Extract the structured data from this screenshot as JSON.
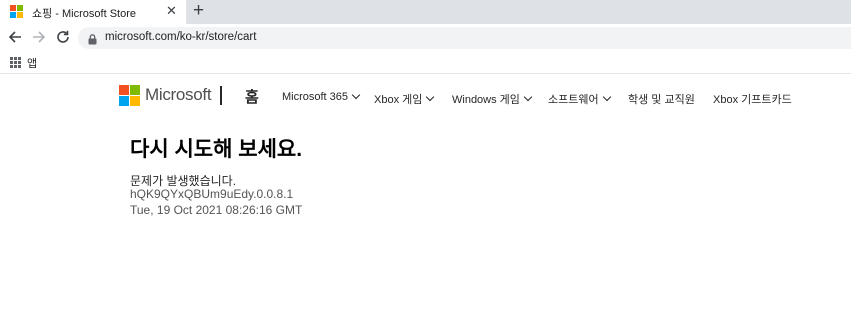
{
  "browser": {
    "tab": {
      "title": "쇼핑 - Microsoft Store",
      "close_glyph": "✕"
    },
    "new_tab_glyph": "+",
    "address_bar": {
      "url": "microsoft.com/ko-kr/store/cart"
    },
    "bookmarks": {
      "apps_label": "앱"
    }
  },
  "header": {
    "brand": "Microsoft",
    "home_label": "홈",
    "nav": [
      {
        "label": "Microsoft 365",
        "has_dropdown": true
      },
      {
        "label": "Xbox 게임",
        "has_dropdown": true
      },
      {
        "label": "Windows 게임",
        "has_dropdown": true
      },
      {
        "label": "소프트웨어",
        "has_dropdown": true
      },
      {
        "label": "학생 및 교직원",
        "has_dropdown": false
      },
      {
        "label": "Xbox 기프트카드",
        "has_dropdown": false
      }
    ]
  },
  "error": {
    "title": "다시 시도해 보세요.",
    "message": "문제가 발생했습니다.",
    "code": "hQK9QYxQBUm9uEdy.0.0.8.1",
    "timestamp": "Tue, 19 Oct 2021 08:26:16 GMT"
  },
  "colors": {
    "logo_red": "#f25022",
    "logo_green": "#7fba00",
    "logo_blue": "#00a4ef",
    "logo_yellow": "#ffb900",
    "tabstrip": "#dee1e6",
    "omnibox": "#f1f3f4"
  },
  "icons": [
    "microsoft-store-favicon",
    "close-icon",
    "plus-icon",
    "back-arrow-icon",
    "forward-arrow-icon",
    "reload-icon",
    "lock-icon",
    "apps-grid-icon",
    "microsoft-logo",
    "chevron-down-icon"
  ]
}
